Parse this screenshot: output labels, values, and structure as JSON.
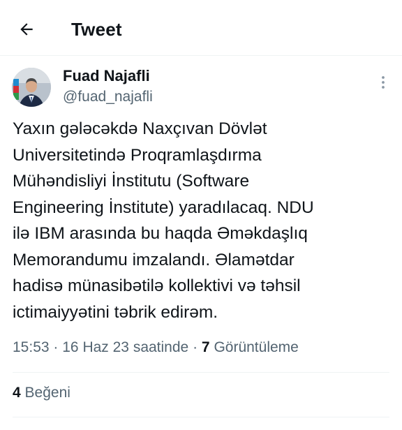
{
  "header": {
    "title": "Tweet",
    "back_icon": "arrow-left-icon"
  },
  "author": {
    "display_name": "Fuad Najafli",
    "handle": "@fuad_najafli",
    "more_icon": "more-vertical-icon"
  },
  "tweet": {
    "text": "Yaxın gələcəkdə Naxçıvan Dövlət\nUniversitetində Proqramlaşdırma\nMühəndisliyi İnstitutu (Software\nEngineering İnstitute) yaradılacaq. NDU\nilə IBM arasında bu haqda Əməkdaşlıq\nMemorandumu imzalandı. Əlamətdar\nhadisə münasibətilə kollektivi və təhsil\nictimaiyyətini təbrik edirəm."
  },
  "meta": {
    "time": "15:53",
    "separator": "·",
    "date": "16 Haz 23 saatinde",
    "views_count": "7",
    "views_label": "Görüntüleme"
  },
  "engagement": {
    "likes_count": "4",
    "likes_label": "Beğeni"
  },
  "colors": {
    "primary_text": "#0f1419",
    "secondary_text": "#536471",
    "divider": "#eff3f4",
    "background": "#ffffff"
  }
}
